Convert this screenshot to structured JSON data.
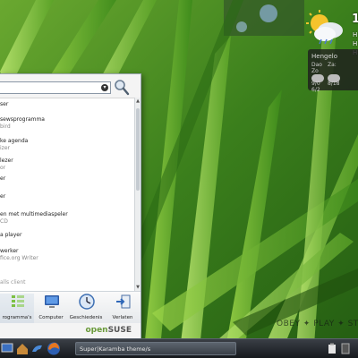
{
  "weather": {
    "current_temp": "1",
    "meta_lines": [
      "H",
      "H",
      "H"
    ],
    "city": "Hengelo",
    "days": [
      "Dao",
      "Za:",
      "Zo"
    ],
    "temps": [
      "9/0",
      "8/18",
      "6/2"
    ]
  },
  "start_menu": {
    "search_value": "",
    "results": [
      {
        "line1": "ser",
        "line2": ""
      },
      {
        "line1": "sewsprogramma",
        "line2": "bird"
      },
      {
        "line1": "ke agenda",
        "line2": "izer"
      },
      {
        "line1": "lezer",
        "line2": "or"
      },
      {
        "line1": "er",
        "line2": ""
      },
      {
        "line1": "er",
        "line2": ""
      },
      {
        "line1": "en met multimediaspeler",
        "line2": "CD"
      },
      {
        "line1": "a player",
        "line2": ""
      },
      {
        "line1": "werker",
        "line2": "fice.org Writer"
      }
    ],
    "hint": "alls client",
    "bottom_items": [
      {
        "label": "rogramma's"
      },
      {
        "label": "Computer"
      },
      {
        "label": "Geschiedenis"
      },
      {
        "label": "Verlaten"
      }
    ],
    "brand_open": "open",
    "brand_suse": "SUSE"
  },
  "taskbar": {
    "task_label": "Super|Karamba theme/s"
  },
  "desktop": {
    "logout_text": "OBEY ✦ PLAY ✦ STOP"
  },
  "colors": {
    "taskbar": "#16191d",
    "menu_bg": "#f4f4f4",
    "suse_green": "#6a9a3a"
  }
}
